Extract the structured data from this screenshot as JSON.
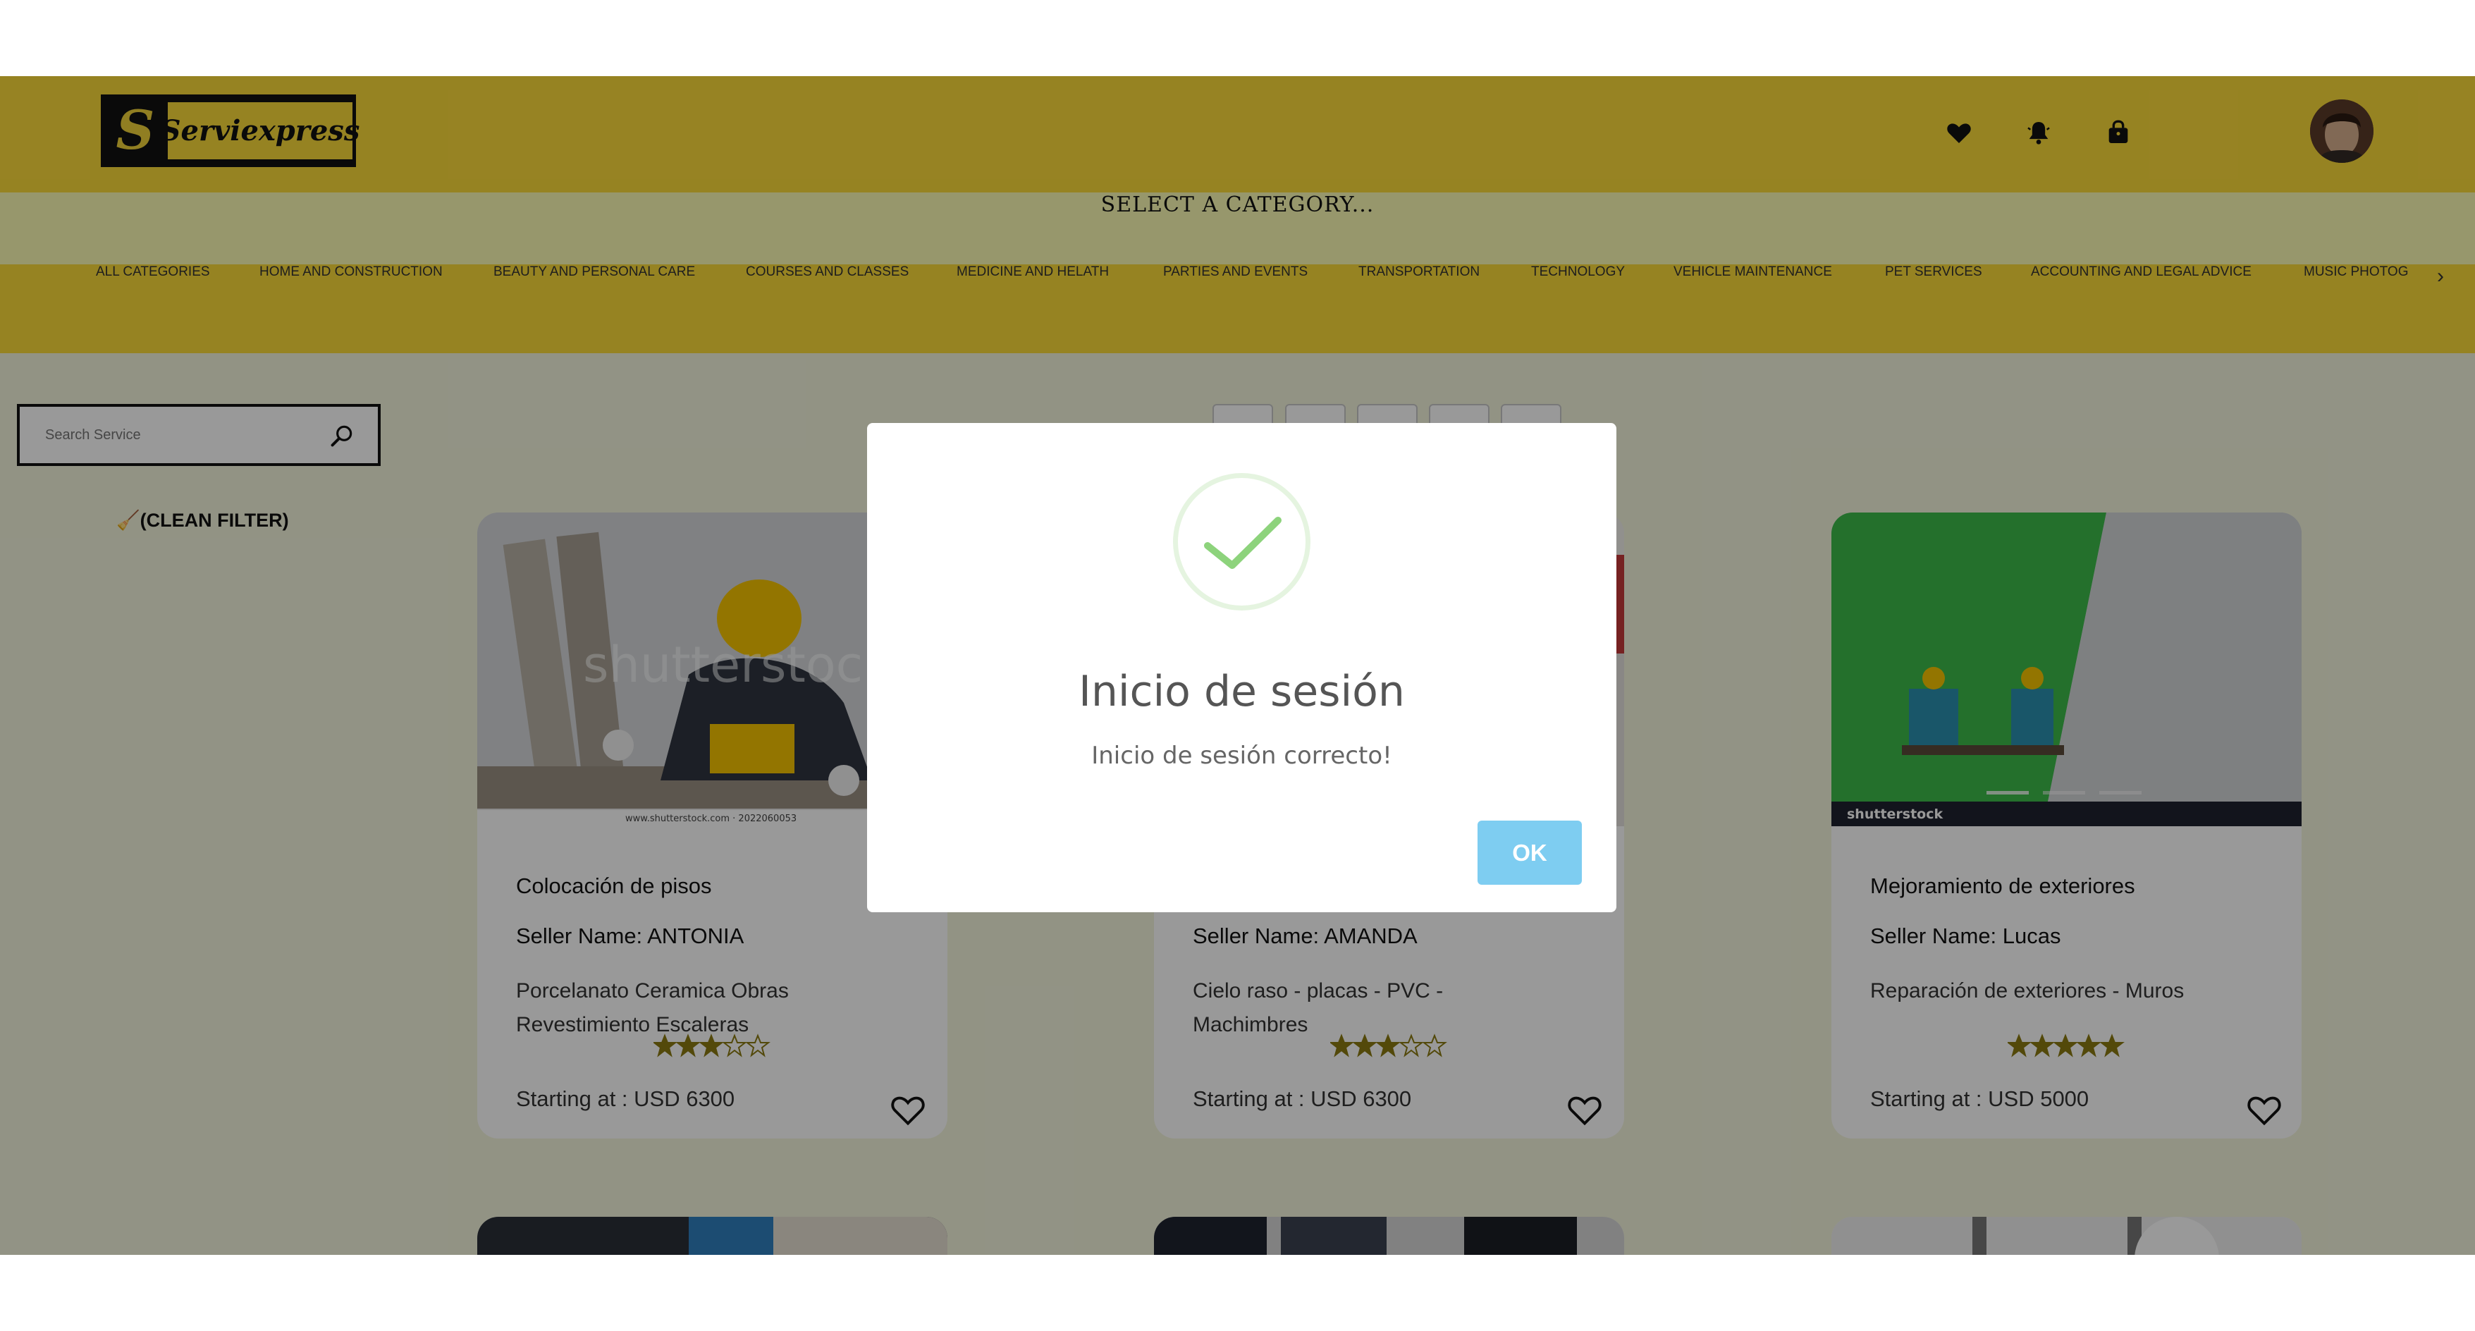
{
  "brand": {
    "logo_letter": "S",
    "logo_text": "Serviexpress"
  },
  "header_icons": [
    "heart-icon",
    "bell-icon",
    "bag-icon"
  ],
  "category_bar": {
    "title": "SELECT A CATEGORY..."
  },
  "categories": [
    "ALL CATEGORIES",
    "HOME AND CONSTRUCTION",
    "BEAUTY AND PERSONAL CARE",
    "COURSES AND CLASSES",
    "MEDICINE AND HELATH",
    "PARTIES AND EVENTS",
    "TRANSPORTATION",
    "TECHNOLOGY",
    "VEHICLE MAINTENANCE",
    "PET SERVICES",
    "ACCOUNTING AND LEGAL ADVICE",
    "MUSIC PHOTOG"
  ],
  "category_next": "›",
  "search": {
    "placeholder": "Search Service"
  },
  "clean_filter": "(CLEAN FILTER)",
  "cards": [
    {
      "title": "Colocación de pisos",
      "seller": "Seller Name: ANTONIA",
      "description": "Porcelanato Ceramica Obras Revestimiento Escaleras",
      "rating": 3,
      "price": "Starting at : USD 6300",
      "image_caption": "www.shutterstock.com · 2022060053",
      "watermark": "shutterstock"
    },
    {
      "title": "",
      "seller": "Seller Name: AMANDA",
      "description": "Cielo raso - placas - PVC - Machimbres",
      "rating": 3,
      "price": "Starting at : USD 6300"
    },
    {
      "title": "Mejoramiento de exteriores",
      "seller": "Seller Name: Lucas",
      "description": "Reparación de exteriores - Muros",
      "rating": 5,
      "price": "Starting at : USD 5000",
      "image_caption": "shutterstock"
    }
  ],
  "modal": {
    "title": "Inicio de sesión",
    "text": "Inicio de sesión correcto!",
    "ok_label": "OK"
  },
  "colors": {
    "header": "#fbdb3a",
    "category_bar": "#fcfcb4",
    "page_bg": "#f3f5dd",
    "star": "#8a7a12",
    "ok_button": "#7ecdf1",
    "check": "#8dd37c"
  }
}
